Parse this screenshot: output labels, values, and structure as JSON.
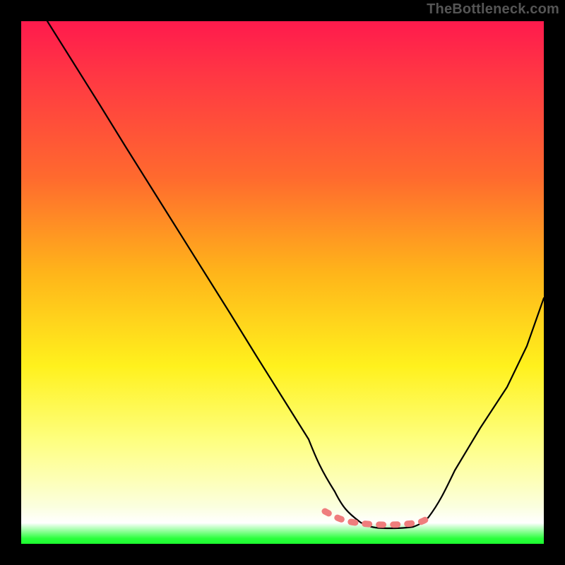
{
  "watermark": "TheBottleneck.com",
  "gradient_colors": {
    "top": "#ff1a4d",
    "mid_upper": "#ff6a2e",
    "mid": "#fff11d",
    "lower": "#fbffe0",
    "bottom_edge": "#1dff30"
  },
  "chart_data": {
    "type": "line",
    "title": "",
    "xlabel": "",
    "ylabel": "",
    "xlim": [
      0,
      100
    ],
    "ylim": [
      0,
      100
    ],
    "grid": false,
    "legend": false,
    "series": [
      {
        "name": "bottleneck-curve",
        "color": "#000000",
        "x": [
          5,
          10,
          15,
          20,
          25,
          30,
          35,
          40,
          45,
          50,
          55,
          58,
          60,
          63,
          66,
          70,
          73,
          76,
          78,
          82,
          86,
          90,
          94,
          98,
          100
        ],
        "y": [
          100,
          92,
          84,
          76,
          68,
          60,
          52,
          44,
          36,
          28,
          20,
          14,
          10,
          6,
          4,
          3,
          3,
          3,
          4,
          8,
          14,
          22,
          31,
          41,
          47
        ]
      },
      {
        "name": "highlight-band",
        "color": "#f07878",
        "x": [
          58,
          60,
          63,
          66,
          70,
          73,
          76,
          78
        ],
        "y": [
          6,
          5,
          4.5,
          4,
          4,
          4,
          4.3,
          5
        ]
      }
    ],
    "annotations": []
  }
}
